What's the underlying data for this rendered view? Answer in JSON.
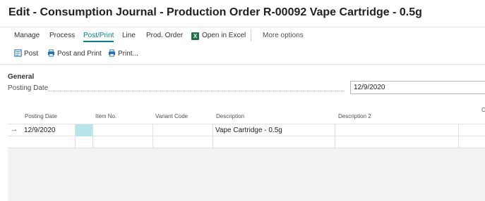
{
  "title": "Edit - Consumption Journal - Production Order R-00092 Vape Cartridge - 0.5g",
  "menu": {
    "manage": "Manage",
    "process": "Process",
    "post_print": "Post/Print",
    "line": "Line",
    "prod_order": "Prod. Order",
    "open_excel": "Open in Excel",
    "more_options": "More options"
  },
  "actions": {
    "post": "Post",
    "post_and_print": "Post and Print",
    "print": "Print..."
  },
  "general": {
    "heading": "General",
    "posting_date_label": "Posting Date",
    "posting_date_value": "12/9/2020"
  },
  "grid": {
    "columns": {
      "posting_date": "Posting Date",
      "item_no": "Item No.",
      "variant_code": "Variant Code",
      "description": "Description",
      "description_2": "Description 2",
      "truncated": "C"
    },
    "rows": [
      {
        "posting_date": "12/9/2020",
        "item_no": "",
        "variant_code": "",
        "description": "Vape Cartridge - 0.5g",
        "description_2": ""
      }
    ]
  },
  "colors": {
    "accent": "#008489",
    "excel_green": "#1e7145",
    "selected_cell": "#b6e6ea"
  }
}
